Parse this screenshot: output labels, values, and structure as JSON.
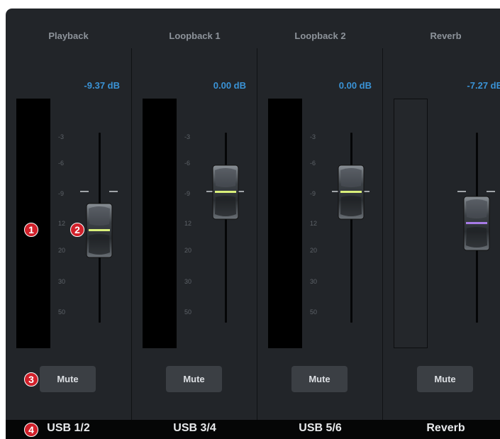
{
  "channels": [
    {
      "title": "Playback",
      "gain": "-9.37 dB",
      "mute_label": "Mute",
      "output": "USB 1/2",
      "fader_level": -9.37
    },
    {
      "title": "Loopback 1",
      "gain": "0.00 dB",
      "mute_label": "Mute",
      "output": "USB 3/4",
      "fader_level": 0
    },
    {
      "title": "Loopback 2",
      "gain": "0.00 dB",
      "mute_label": "Mute",
      "output": "USB 5/6",
      "fader_level": 0
    },
    {
      "title": "Reverb",
      "gain": "-7.27 dB",
      "mute_label": "Mute",
      "output": "Reverb",
      "fader_level": -7.27
    }
  ],
  "scale": [
    "-3",
    "-6",
    "-9",
    "12",
    "20",
    "30",
    "50"
  ],
  "callouts": [
    "1",
    "2",
    "3",
    "4"
  ],
  "colors": {
    "accent": "#3a93d6",
    "fader_line_main": "#d9f07a",
    "fader_line_reverb": "#a77be6",
    "callout": "#d1202a"
  }
}
